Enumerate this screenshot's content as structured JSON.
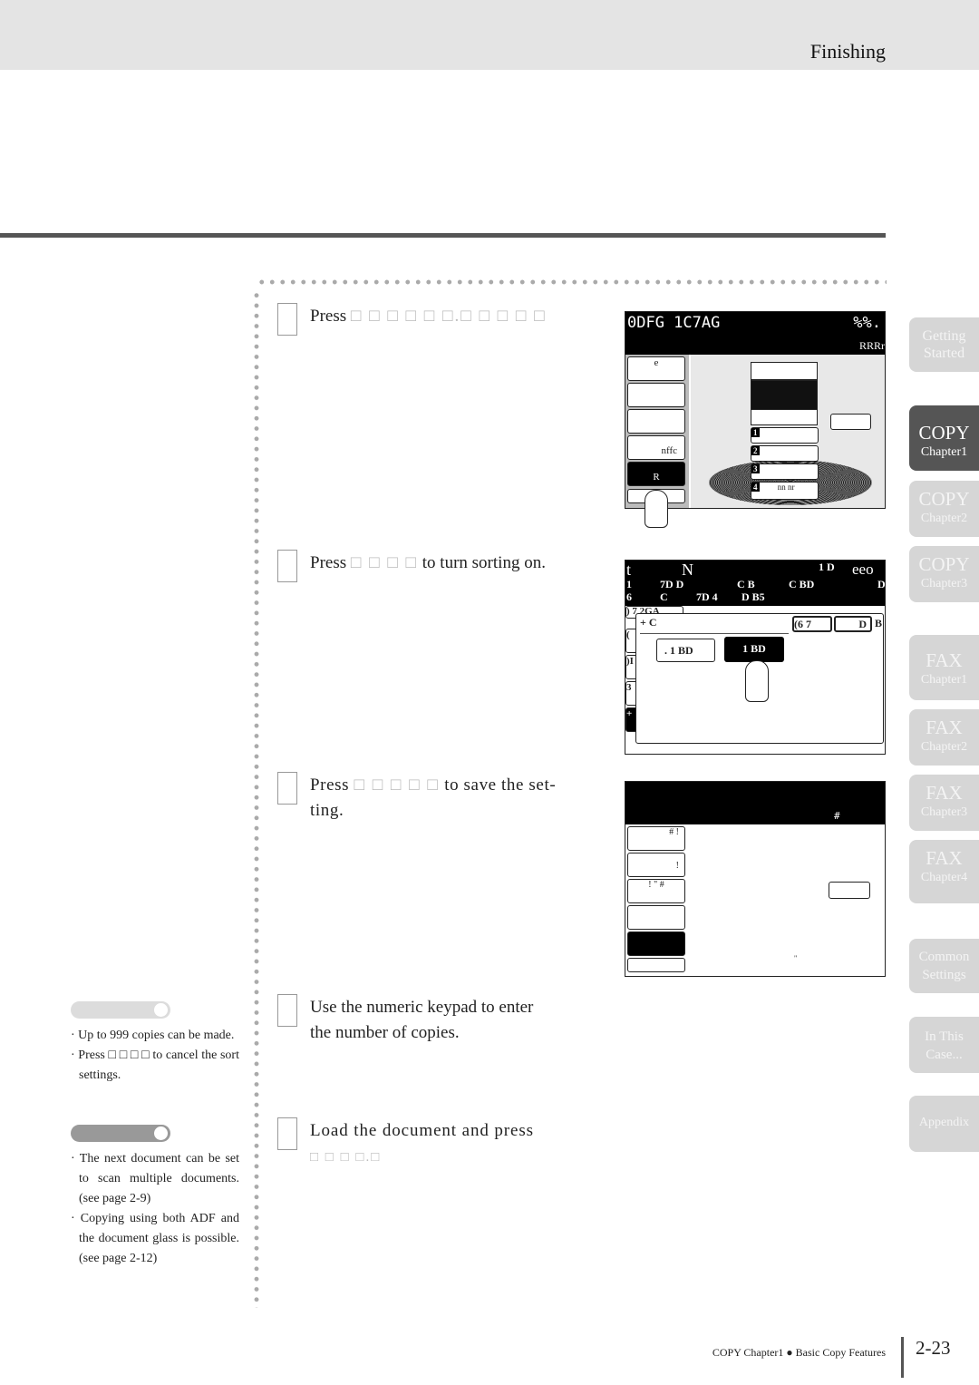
{
  "header": {
    "title": "Finishing"
  },
  "steps": [
    {
      "prefix": "Press ",
      "keys": "□ □ □ □ □ □.□ □ □ □ □",
      "suffix": ""
    },
    {
      "prefix": "Press ",
      "keys": "□ □ □ □",
      "suffix": "to turn sorting on."
    },
    {
      "prefix": "Press ",
      "keys": "□ □ □ □ □",
      "suffix": "to save the set-",
      "line2": "ting."
    },
    {
      "prefix": "Use the numeric keypad to enter",
      "line2": "the number of copies."
    },
    {
      "prefix": "Load the document and press",
      "keys": "□ □ □ □.□"
    }
  ],
  "screen1": {
    "title": "0DFG 1C7AG",
    "right": "%%.",
    "sub": "RRRr",
    "buttons": [
      "e",
      "",
      "",
      "nffc",
      "R",
      ""
    ],
    "trays": [
      "1",
      "2",
      "3",
      "4"
    ],
    "tray4_text": "nn  nr"
  },
  "screen2": {
    "row1": [
      "t",
      "N",
      "1  D",
      "eeo"
    ],
    "row2": [
      "1",
      "7D  D",
      "C  B",
      "C  BD",
      "D"
    ],
    "row3": [
      "6",
      "C",
      "7D  4",
      "D  B5"
    ],
    "side": [
      ")  7  2GA",
      "(",
      ")I",
      "3",
      "+"
    ],
    "dialog_title": "+        C",
    "dialog_btns": [
      "(6  7",
      "D"
    ],
    "dialog_right": "B",
    "option1": ".    1  BD",
    "option2": "1  BD"
  },
  "screen3": {
    "top": "#",
    "buttons": [
      "#  !",
      "!",
      "!  \"  #",
      "",
      "",
      ""
    ],
    "mark": "\""
  },
  "notes": {
    "note1": [
      "· Up to 999 copies can be made.",
      "· Press □ □ □ □ to cancel the sort settings."
    ],
    "note2": [
      "· The next document can be set to scan multiple documents. (see page 2-9)",
      "· Copying using both ADF and the document glass is possible. (see page 2-12)"
    ]
  },
  "tabs": [
    {
      "t1": "Getting",
      "t2": "Started",
      "active": false
    },
    {
      "t1": "COPY",
      "t2": "Chapter1",
      "active": true
    },
    {
      "t1": "COPY",
      "t2": "Chapter2",
      "active": false
    },
    {
      "t1": "COPY",
      "t2": "Chapter3",
      "active": false
    },
    {
      "t1": "FAX",
      "t2": "Chapter1",
      "active": false
    },
    {
      "t1": "FAX",
      "t2": "Chapter2",
      "active": false
    },
    {
      "t1": "FAX",
      "t2": "Chapter3",
      "active": false
    },
    {
      "t1": "FAX",
      "t2": "Chapter4",
      "active": false
    },
    {
      "t1": "Common",
      "t2": "Settings",
      "active": false
    },
    {
      "t1": "In This",
      "t2": "Case...",
      "active": false
    },
    {
      "t1": "Appendix",
      "t2": "",
      "active": false
    }
  ],
  "footer": {
    "section": "COPY Chapter1",
    "bullet": "●",
    "chapter": "Basic Copy Features",
    "page": "2-23"
  },
  "colors": {
    "active_tab": "#555555",
    "inactive_tab": "#d6d6d6",
    "rule": "#555555"
  }
}
